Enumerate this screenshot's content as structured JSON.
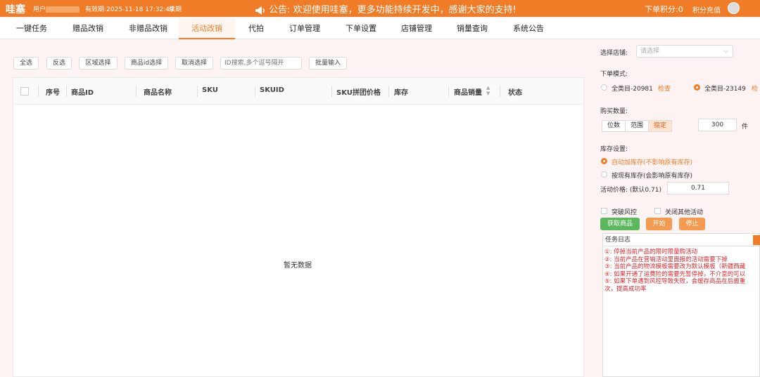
{
  "header": {
    "brand": "哇塞",
    "user_label": "用户",
    "expiry": "有效期:2025-11-18 17:32:49",
    "renew": "续期",
    "notice": "公告: 欢迎使用哇塞，更多功能持续开发中，感谢大家的支持!",
    "points": "下单积分:0",
    "recharge": "积分充值"
  },
  "tabs": [
    "一键任务",
    "赠品改销",
    "非赠品改销",
    "活动改销",
    "代拍",
    "订单管理",
    "下单设置",
    "店铺管理",
    "销量查询",
    "系统公告"
  ],
  "active_tab": "活动改销",
  "toolbar": {
    "select_all": "全选",
    "invert": "反选",
    "region": "区域选择",
    "id_select": "商品id选择",
    "cancel": "取消选择",
    "search_placeholder": "ID搜索,多个逗号隔开",
    "batch_input": "批量输入"
  },
  "table": {
    "columns": [
      "序号",
      "商品ID",
      "商品名称",
      "SKU",
      "SKUID",
      "SKU拼团价格",
      "库存",
      "商品销量",
      "状态"
    ],
    "empty_text": "暂无数据"
  },
  "panel": {
    "store_label": "选择店铺:",
    "store_placeholder": "请选择",
    "order_mode_label": "下单模式:",
    "mode_1": "全类目-20981",
    "mode_1_check": "检查",
    "mode_2": "全类目-23149",
    "mode_2_check": "检",
    "qty_label": "购买数量:",
    "qty_options": [
      "位数",
      "范围",
      "指定"
    ],
    "qty_value": "300",
    "qty_unit": "件",
    "stock_label": "库存设置:",
    "stock_opt_1": "自动加库存(不影响原有库存)",
    "stock_opt_2": "按现有库存(会影响原有库存)",
    "price_label": "活动价格: (默认0.71)",
    "price_value": "0.71",
    "breakthrough": "突破风控",
    "close_other": "关闭其他活动",
    "get_products": "获取商品",
    "start": "开始",
    "stop": "停止",
    "log_title": "任务日志",
    "log_lines": [
      "①: 停掉当前产品的限时限量购活动",
      "②: 当前产品在营销活动里面报的活动需要下掉",
      "③: 当前产品的物流模板需要改为默认模板（新疆西藏",
      "④: 如果开通了运费险的需要先暂停掉，不介意的可以",
      "⑤: 如果下单遇到风控导致失败，会缓存商品在后面重",
      "次，提高成功率"
    ]
  },
  "colors": {
    "accent": "#f07c28",
    "log_text": "#d9262c",
    "green": "#5cb85c"
  }
}
